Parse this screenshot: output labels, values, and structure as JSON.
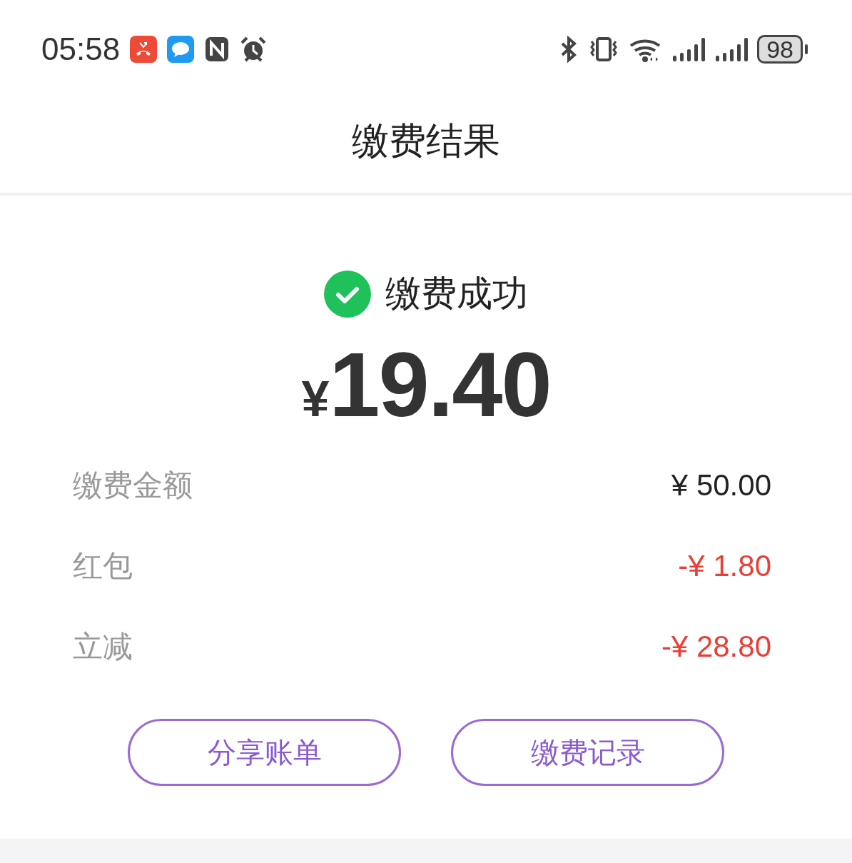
{
  "status_bar": {
    "time": "05:58",
    "battery": "98"
  },
  "header": {
    "title": "缴费结果"
  },
  "result": {
    "status": "缴费成功",
    "currency": "¥",
    "amount": "19.40"
  },
  "rows": [
    {
      "label": "缴费金额",
      "value": "¥ 50.00",
      "kind": "normal"
    },
    {
      "label": "红包",
      "value": "-¥ 1.80",
      "kind": "deduction"
    },
    {
      "label": "立减",
      "value": "-¥ 28.80",
      "kind": "deduction"
    }
  ],
  "buttons": [
    {
      "label": "分享账单"
    },
    {
      "label": "缴费记录"
    }
  ]
}
